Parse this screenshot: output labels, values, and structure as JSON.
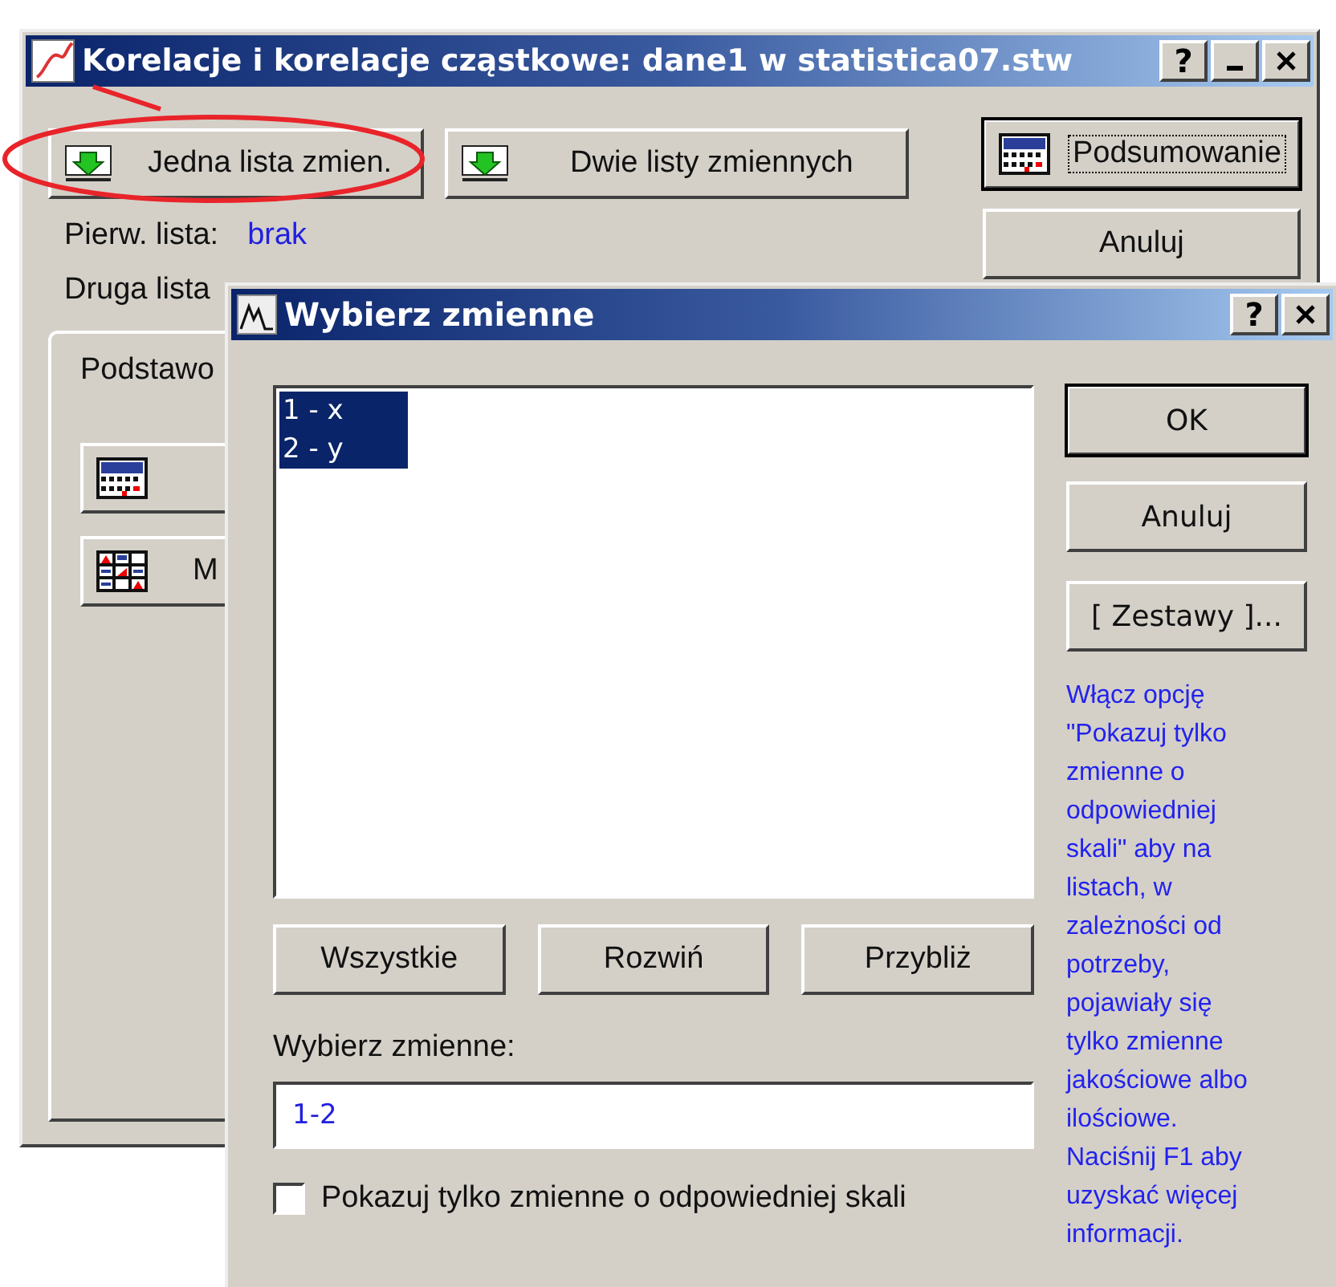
{
  "main_window": {
    "title": "Korelacje i korelacje cząstkowe: dane1 w statistica07.stw",
    "title_buttons": [
      {
        "kind": "help",
        "label": "?"
      },
      {
        "kind": "minimize"
      },
      {
        "kind": "close"
      }
    ],
    "list_buttons": [
      {
        "label": "Jedna lista zmien.",
        "kind": "list",
        "default": false
      },
      {
        "label": "Dwie listy zmiennych",
        "kind": "list",
        "default": false
      }
    ],
    "side_buttons": [
      {
        "label": "Podsumowanie",
        "kind": "summary",
        "default": true
      },
      {
        "label": "Anuluj",
        "kind": "plain",
        "default": false
      }
    ],
    "fields": [
      {
        "label": "Pierw. lista:",
        "value": "brak"
      },
      {
        "label": "Druga lista"
      }
    ],
    "tab": {
      "label": "Podstawo"
    },
    "tab_buttons": [
      {
        "kind": "summary"
      },
      {
        "kind": "matrix",
        "label": "M"
      }
    ]
  },
  "dialog": {
    "title": "Wybierz zmienne",
    "title_buttons": [
      {
        "kind": "help",
        "label": "?"
      },
      {
        "kind": "close"
      }
    ],
    "variables": [
      {
        "label": "1 - x",
        "selected": true
      },
      {
        "label": "2 - y",
        "selected": true
      }
    ],
    "side_buttons": [
      {
        "label": "OK",
        "default": true
      },
      {
        "label": "Anuluj",
        "default": false
      },
      {
        "label": "[ Zestawy ]...",
        "default": false
      }
    ],
    "help_text": "Włącz opcję \"Pokazuj tylko zmienne o odpowiedniej skali\" aby na listach, w zależności od potrzeby, pojawiały się tylko zmienne jakościowe albo ilościowe. Naciśnij F1 aby uzyskać więcej informacji.",
    "bottom_buttons": [
      "Wszystkie",
      "Rozwiń",
      "Przybliż"
    ],
    "field_label": "Wybierz zmienne:",
    "field_value": "1-2",
    "checkbox": {
      "label": "Pokazuj tylko zmienne o odpowiedniej skali",
      "checked": false
    }
  },
  "annotation": {
    "kind": "ellipse"
  }
}
